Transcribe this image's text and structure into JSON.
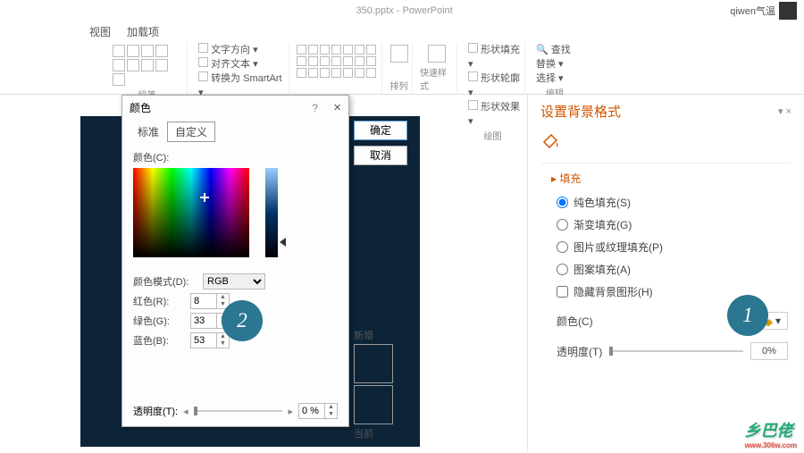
{
  "title": "350.pptx - PowerPoint",
  "user": "qiwen气温",
  "menu": {
    "view": "视图",
    "addin": "加载项"
  },
  "ribbon": {
    "paragraph": "段落",
    "text_direction": "文字方向",
    "align_text": "对齐文本",
    "smartart": "转换为 SmartArt",
    "arrange": "排列",
    "quick_style": "快速样式",
    "shape_fill": "形状填充",
    "shape_outline": "形状轮廓",
    "shape_effects": "形状效果",
    "drawing": "绘图",
    "find": "查找",
    "replace": "替换",
    "select": "选择",
    "editing": "编辑"
  },
  "dialog": {
    "title": "颜色",
    "help": "?",
    "close": "×",
    "tab_standard": "标准",
    "tab_custom": "自定义",
    "ok": "确定",
    "cancel": "取消",
    "color_label": "颜色(C):",
    "mode_label": "颜色模式(D):",
    "mode_value": "RGB",
    "red_label": "红色(R):",
    "green_label": "绿色(G):",
    "blue_label": "蓝色(B):",
    "red": "8",
    "green": "33",
    "blue": "53",
    "new": "新增",
    "current": "当前",
    "transparency_label": "透明度(T):",
    "transparency": "0 %"
  },
  "pane": {
    "title": "设置背景格式",
    "section_fill": "填充",
    "opt_solid": "纯色填充(S)",
    "opt_gradient": "渐变填充(G)",
    "opt_picture": "图片或纹理填充(P)",
    "opt_pattern": "图案填充(A)",
    "opt_hide": "隐藏背景图形(H)",
    "color_label": "颜色(C)",
    "transparency_label": "透明度(T)",
    "transparency": "0%"
  },
  "badges": {
    "one": "1",
    "two": "2"
  },
  "watermark": {
    "text": "乡巴佬",
    "url": "www.306w.com"
  }
}
